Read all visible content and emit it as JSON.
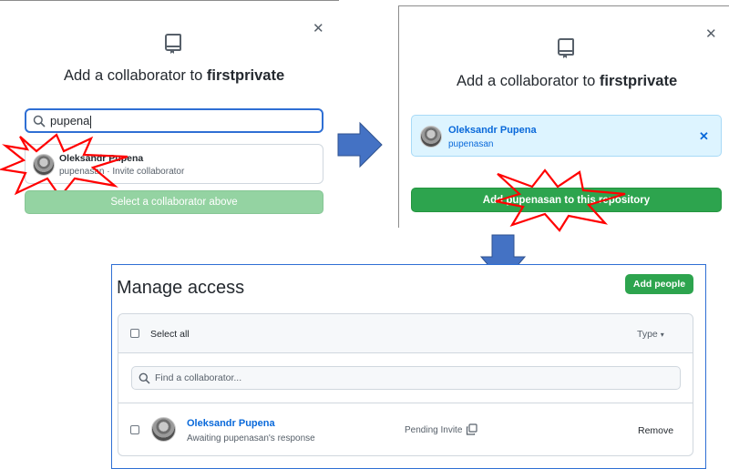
{
  "panel1": {
    "dialog_title_prefix": "Add a collaborator to ",
    "dialog_title_repo": "firstprivate",
    "search": {
      "value": "pupena"
    },
    "suggestion": {
      "name": "Oleksandr Pupena",
      "detail": "pupenasan · Invite collaborator"
    },
    "action_button": "Select a collaborator above",
    "icons": [
      "repo-icon",
      "close-icon",
      "search-icon",
      "avatar"
    ]
  },
  "panel2": {
    "dialog_title_prefix": "Add a collaborator to ",
    "dialog_title_repo": "firstprivate",
    "selected_user": {
      "name": "Oleksandr Pupena",
      "login": "pupenasan"
    },
    "action_button": "Add pupenasan to this repository",
    "icons": [
      "repo-icon",
      "close-icon",
      "remove-icon",
      "avatar"
    ]
  },
  "panel3": {
    "title": "Manage access",
    "add_people_button": "Add people",
    "select_all_label": "Select all",
    "type_filter_label": "Type",
    "find_placeholder": "Find a collaborator...",
    "collaborator": {
      "name": "Oleksandr Pupena",
      "status_text": "Awaiting pupenasan's response",
      "pending_label": "Pending Invite",
      "remove_label": "Remove"
    },
    "icons": [
      "search-icon",
      "copy-icon",
      "caret-down-icon",
      "avatar"
    ]
  },
  "colors": {
    "accent_blue": "#0969da",
    "primary_green": "#2da44e",
    "disabled_green": "#94d3a2",
    "selected_bg": "#ddf4ff",
    "annotation_red": "#ff0000",
    "arrow_blue": "#4472c4"
  }
}
